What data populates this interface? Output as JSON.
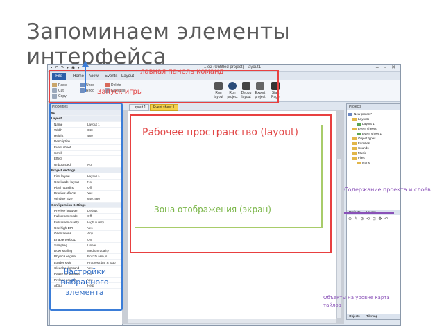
{
  "slide": {
    "title": "Запоминаем элементы интерфейса"
  },
  "app": {
    "quick_access": "▪ ↶ ↷ ▾ ◉ ▾",
    "window_title": "...e2 (Untitled project) - layout1",
    "window_controls": "– ▫ ✕",
    "tabs": [
      "File",
      "Home",
      "View",
      "Events",
      "Layout"
    ],
    "ribbon": {
      "clipboard": [
        "Paste",
        "Cut",
        "Copy"
      ],
      "edit": [
        "Undo",
        "Redo",
        "Delete"
      ],
      "select": "Select all"
    },
    "ribbon_right": [
      "Run layout",
      "Run project",
      "Debug layout",
      "Export project",
      "Start Page"
    ]
  },
  "properties": {
    "header": "Properties",
    "rows": [
      {
        "section": "61"
      },
      {
        "section": "Layout"
      },
      {
        "key": "Name",
        "value": "Layout 1"
      },
      {
        "key": "Width",
        "value": "640"
      },
      {
        "key": "Height",
        "value": "480"
      },
      {
        "key": "Description",
        "value": ""
      },
      {
        "key": "Event sheet",
        "value": ""
      },
      {
        "key": "Scroll",
        "value": ""
      },
      {
        "key": "Effect",
        "value": ""
      },
      {
        "key": "Unbounded",
        "value": "No"
      },
      {
        "section": "Project settings"
      },
      {
        "key": "First layout",
        "value": "Layout 1"
      },
      {
        "key": "Use loader layout",
        "value": "No"
      },
      {
        "key": "Pixel rounding",
        "value": "Off"
      },
      {
        "key": "Preview effects",
        "value": "Yes"
      },
      {
        "key": "Window Size",
        "value": "640, 480"
      },
      {
        "section": "Configuration Settings"
      },
      {
        "key": "Preview browser",
        "value": "Default"
      },
      {
        "key": "Fullscreen mode",
        "value": "Off"
      },
      {
        "key": "Fullscreen quality",
        "value": "High quality"
      },
      {
        "key": "Use high-DPI",
        "value": "Yes"
      },
      {
        "key": "Orientations",
        "value": "Any"
      },
      {
        "key": "Enable WebGL",
        "value": "On"
      },
      {
        "key": "Sampling",
        "value": "Linear"
      },
      {
        "key": "Downscaling",
        "value": "Medium quality"
      },
      {
        "key": "Physics engine",
        "value": "Box2D asm.js"
      },
      {
        "key": "Loader style",
        "value": "Progress bar & logo"
      },
      {
        "key": "Clear background",
        "value": "Yes"
      },
      {
        "key": "Pause on unfocus",
        "value": "No"
      },
      {
        "key": "Preload sounds",
        "value": "Yes"
      },
      {
        "key": "About",
        "value": "Help"
      }
    ]
  },
  "workspace": {
    "tabs": [
      "Layout 1",
      "Event sheet 1"
    ]
  },
  "project": {
    "header": "Projects",
    "tree": [
      {
        "label": "New project*",
        "kind": "root"
      },
      {
        "label": "Layouts",
        "kind": "folder"
      },
      {
        "label": "Layout 1",
        "kind": "layout"
      },
      {
        "label": "Event sheets",
        "kind": "folder"
      },
      {
        "label": "Event sheet 1",
        "kind": "layout"
      },
      {
        "label": "Object types",
        "kind": "folder"
      },
      {
        "label": "Families",
        "kind": "folder"
      },
      {
        "label": "Sounds",
        "kind": "folder"
      },
      {
        "label": "Music",
        "kind": "folder"
      },
      {
        "label": "Files",
        "kind": "folder"
      },
      {
        "label": "Icons",
        "kind": "folder"
      }
    ],
    "sub_tabs": [
      "Projects",
      "Layers"
    ],
    "bottom_tabs": [
      "Objects",
      "Tilemap"
    ]
  },
  "annotations": {
    "main_panel": "Главная панель команд",
    "run_game": "Запуск игры",
    "workspace": "Рабочее пространство (layout)",
    "display_zone": "Зона отображения (экран)",
    "project_content": "Содержание проекта и слоёв",
    "selected_settings": "Настройки выбранного элемента",
    "tilemap_objects": "Объекты на уровне карта тайлов"
  },
  "colors": {
    "annotation_red": "#e24848",
    "annotation_green": "#7ab648",
    "annotation_purple": "#8a52b8",
    "annotation_blue": "#2f6cc4",
    "file_tab": "#2a5ea8",
    "active_doc_tab": "#f4d04a"
  }
}
